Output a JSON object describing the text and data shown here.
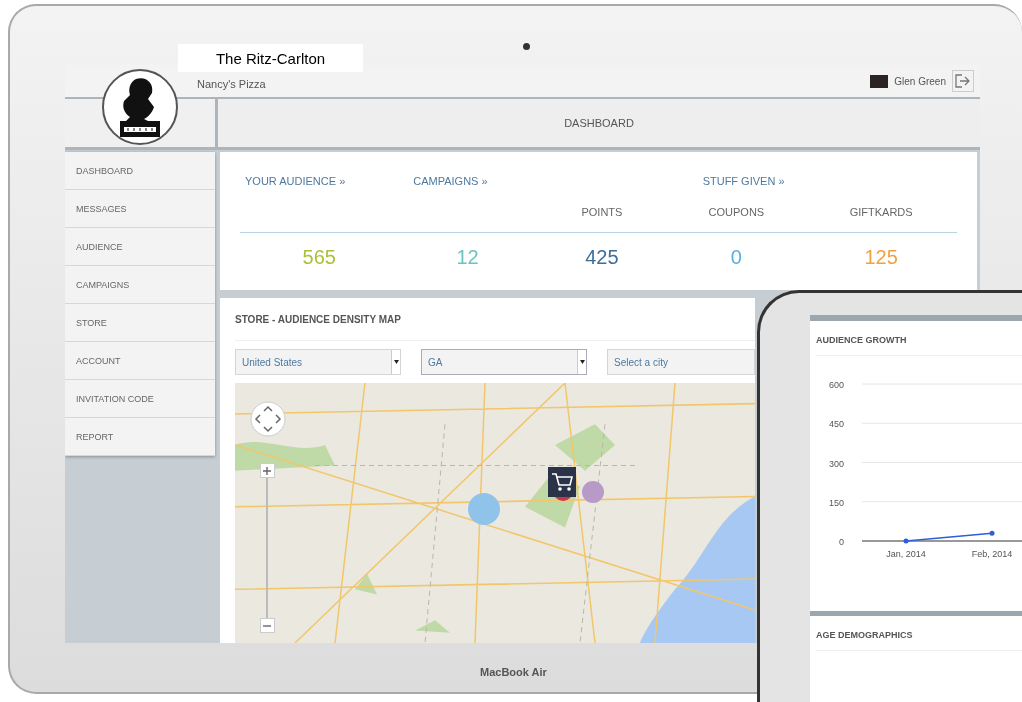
{
  "caption": "The Ritz-Carlton",
  "laptop": {
    "brand": "MacBook Air"
  },
  "header": {
    "business": "Nancy's Pizza",
    "user": "Glen Green"
  },
  "page_title": "DASHBOARD",
  "sidebar": {
    "items": [
      {
        "label": "DASHBOARD",
        "selected": false
      },
      {
        "label": "MESSAGES",
        "selected": false
      },
      {
        "label": "AUDIENCE",
        "selected": false
      },
      {
        "label": "CAMPAIGNS",
        "selected": false
      },
      {
        "label": "STORE",
        "selected": false
      },
      {
        "label": "ACCOUNT",
        "selected": false
      },
      {
        "label": "INVITATION CODE",
        "selected": false
      },
      {
        "label": "REPORT",
        "selected": false
      }
    ]
  },
  "stats": {
    "links": [
      {
        "label": "YOUR AUDIENCE »"
      },
      {
        "label": "CAMPAIGNS »"
      },
      {
        "label": "STUFF GIVEN »"
      }
    ],
    "items": [
      {
        "value": "565",
        "color": "#a9c23a"
      },
      {
        "value": "12",
        "color": "#6cc4bf"
      },
      {
        "label": "POINTS",
        "value": "425",
        "color": "#3f6e98"
      },
      {
        "label": "COUPONS",
        "value": "0",
        "color": "#5aafe0"
      },
      {
        "label": "GIFTKARDS",
        "value": "125",
        "color": "#f0a23e"
      }
    ]
  },
  "map_panel": {
    "title": "STORE - AUDIENCE DENSITY MAP",
    "selects": [
      {
        "value": "United States"
      },
      {
        "value": "GA"
      },
      {
        "placeholder": "Select a city"
      }
    ]
  },
  "tablet": {
    "growth": {
      "title": "AUDIENCE GROWTH",
      "chart_data": {
        "type": "line",
        "categories": [
          "Jan, 2014",
          "Feb, 2014"
        ],
        "series": [
          {
            "color": "#2f5fd6",
            "values": [
              0,
              30
            ]
          }
        ],
        "ylim": [
          0,
          600
        ],
        "yticks": [
          0,
          150,
          300,
          450,
          600
        ],
        "grid": true
      }
    },
    "age_title": "AGE DEMOGRAPHICS"
  }
}
